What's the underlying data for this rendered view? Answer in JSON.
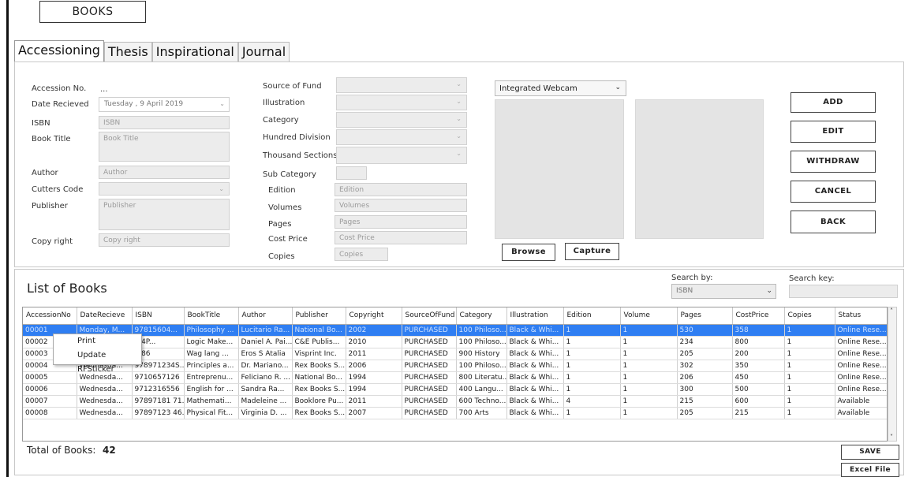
{
  "app": {
    "title": "BOOKS"
  },
  "tabs": [
    "Accessioning",
    "Thesis",
    "Inspirational",
    "Journal"
  ],
  "form": {
    "accession_no_label": "Accession No.",
    "accession_no_value": "...",
    "date_received_label": "Date Recieved",
    "date_received_value": "Tuesday , 9  April  2019",
    "isbn_label": "ISBN",
    "isbn_placeholder": "ISBN",
    "book_title_label": "Book Title",
    "book_title_placeholder": "Book Title",
    "author_label": "Author",
    "author_placeholder": "Author",
    "cutters_code_label": "Cutters Code",
    "publisher_label": "Publisher",
    "publisher_placeholder": "Publisher",
    "copyright_label": "Copy right",
    "copyright_placeholder": "Copy right",
    "source_of_fund_label": "Source of Fund",
    "illustration_label": "Illustration",
    "category_label": "Category",
    "hundred_division_label": "Hundred Division",
    "thousand_sections_label": "Thousand Sections",
    "sub_category_label": "Sub Category",
    "edition_label": "Edition",
    "edition_placeholder": "Edition",
    "volumes_label": "Volumes",
    "volumes_placeholder": "Volumes",
    "pages_label": "Pages",
    "pages_placeholder": "Pages",
    "cost_price_label": "Cost Price",
    "cost_price_placeholder": "Cost Price",
    "copies_label": "Copies",
    "copies_placeholder": "Copies"
  },
  "camera": {
    "device": "Integrated Webcam",
    "browse_label": "Browse",
    "capture_label": "Capture"
  },
  "actions": {
    "add": "ADD",
    "edit": "EDIT",
    "withdraw": "WITHDRAW",
    "cancel": "CANCEL",
    "back": "BACK"
  },
  "list": {
    "title": "List of Books",
    "search_by_label": "Search by:",
    "search_by_value": "ISBN",
    "search_key_label": "Search key:",
    "total_label": "Total of Books:",
    "total_value": "42",
    "save_label": "SAVE",
    "excel_label": "Excel File"
  },
  "context_menu": {
    "print": "Print",
    "update_rfsticker": "Update RFSticker"
  },
  "table": {
    "columns": [
      "AccessionNo",
      "DateRecieve",
      "ISBN",
      "BookTitle",
      "Author",
      "Publisher",
      "Copyright",
      "SourceOfFund",
      "Category",
      "Illustration",
      "Edition",
      "Volume",
      "Pages",
      "CostPrice",
      "Copies",
      "Status"
    ],
    "rows": [
      [
        "00001",
        "Monday, M...",
        "97815604...",
        "Philosophy ...",
        "Lucitario Ra...",
        "National Bo...",
        "2002",
        "PURCHASED",
        "100 Philoso...",
        "Black & Whi...",
        "1",
        "1",
        "530",
        "358",
        "1",
        "Online Rese..."
      ],
      [
        "00002",
        "",
        "...4P...",
        "Logic Make...",
        "Daniel A. Pai...",
        "C&E Publis...",
        "2010",
        "PURCHASED",
        "100 Philoso...",
        "Black & Whi...",
        "1",
        "1",
        "234",
        "800",
        "1",
        "Online Rese..."
      ],
      [
        "00003",
        "",
        "...86",
        "Wag lang ...",
        "Eros S Atalia",
        "Visprint Inc.",
        "2011",
        "PURCHASED",
        "900 History",
        "Black & Whi...",
        "1",
        "1",
        "205",
        "200",
        "1",
        "Online Rese..."
      ],
      [
        "00004",
        "Wednesda...",
        "978971234S...",
        "Principles a...",
        "Dr. Mariano...",
        "Rex Books S...",
        "2006",
        "PURCHASED",
        "100 Philoso...",
        "Black & Whi...",
        "1",
        "1",
        "302",
        "350",
        "1",
        "Online Rese..."
      ],
      [
        "00005",
        "Wednesda...",
        "9710657126",
        "Entreprenu...",
        "Feliciano R. ...",
        "National Bo...",
        "1994",
        "PURCHASED",
        "800 Literatu...",
        "Black & Whi...",
        "1",
        "1",
        "206",
        "450",
        "1",
        "Online Rese..."
      ],
      [
        "00006",
        "Wednesda...",
        "9712316556",
        "English for ...",
        "Sandra Ra...",
        "Rex Books S...",
        "1994",
        "PURCHASED",
        "400 Langu...",
        "Black & Whi...",
        "1",
        "1",
        "300",
        "500",
        "1",
        "Online Rese..."
      ],
      [
        "00007",
        "Wednesda...",
        "97897181 71...",
        "Mathemati...",
        "Madeleine ...",
        "Booklore Pu...",
        "2011",
        "PURCHASED",
        "600 Techno...",
        "Black & Whi...",
        "4",
        "1",
        "215",
        "600",
        "1",
        "Available"
      ],
      [
        "00008",
        "Wednesda...",
        "97897123 46...",
        "Physical Fit...",
        "Virginia D. ...",
        "Rex Books S...",
        "2007",
        "PURCHASED",
        "700 Arts",
        "Black & Whi...",
        "1",
        "1",
        "205",
        "215",
        "1",
        "Available"
      ]
    ]
  }
}
